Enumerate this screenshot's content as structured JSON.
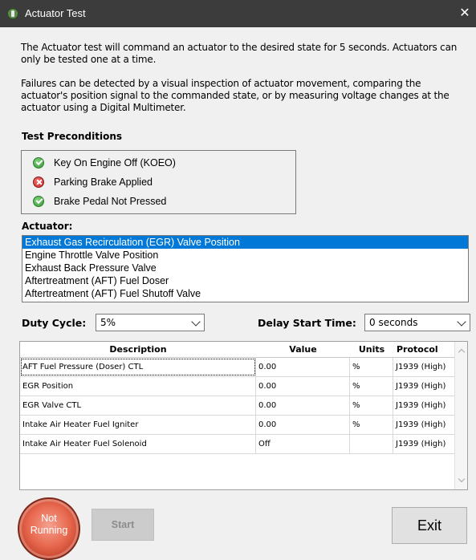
{
  "window": {
    "title": "Actuator Test"
  },
  "intro": {
    "paragraph1": "The Actuator test will command an actuator to the desired state for 5 seconds. Actuators can only be tested one at a time.",
    "paragraph2": "Failures can be detected by a visual inspection of actuator movement, comparing the actuator's position signal to the commanded state, or by measuring voltage changes at the actuator using a Digital Multimeter."
  },
  "preconditions": {
    "heading": "Test Preconditions",
    "items": [
      {
        "label": "Key On Engine Off (KOEO)",
        "status": "pass",
        "icon": "check-icon"
      },
      {
        "label": "Parking Brake Applied",
        "status": "fail",
        "icon": "x-icon"
      },
      {
        "label": "Brake Pedal Not Pressed",
        "status": "pass",
        "icon": "check-icon"
      }
    ]
  },
  "actuator": {
    "label": "Actuator:",
    "items": [
      "Exhaust Gas Recirculation (EGR) Valve Position",
      "Engine Throttle Valve Position",
      "Exhaust Back Pressure Valve",
      "Aftertreatment (AFT) Fuel Doser",
      "Aftertreatment (AFT) Fuel Shutoff Valve"
    ],
    "selected": "Exhaust Gas Recirculation (EGR) Valve Position"
  },
  "duty_cycle": {
    "label": "Duty Cycle:",
    "value": "5%"
  },
  "delay_start": {
    "label": "Delay Start Time:",
    "value": "0 seconds"
  },
  "grid": {
    "columns": [
      "Description",
      "Value",
      "Units",
      "Protocol"
    ],
    "rows": [
      {
        "description": "AFT Fuel Pressure (Doser) CTL",
        "value": "0.00",
        "units": "%",
        "protocol": "J1939 (High)"
      },
      {
        "description": "EGR Position",
        "value": "0.00",
        "units": "%",
        "protocol": "J1939 (High)"
      },
      {
        "description": "EGR Valve CTL",
        "value": "0.00",
        "units": "%",
        "protocol": "J1939 (High)"
      },
      {
        "description": "Intake Air Heater Fuel Igniter",
        "value": "0.00",
        "units": "%",
        "protocol": "J1939 (High)"
      },
      {
        "description": "Intake Air Heater Fuel Solenoid",
        "value": "Off",
        "units": "",
        "protocol": "J1939 (High)"
      }
    ]
  },
  "status": {
    "line1": "Not",
    "line2": "Running"
  },
  "buttons": {
    "start": "Start",
    "exit": "Exit"
  },
  "colors": {
    "titlebar": "#3c3c3c",
    "selection": "#0078d7",
    "status_running_off": "#e86a50",
    "pass": "#3a9a36",
    "fail": "#c82828"
  }
}
